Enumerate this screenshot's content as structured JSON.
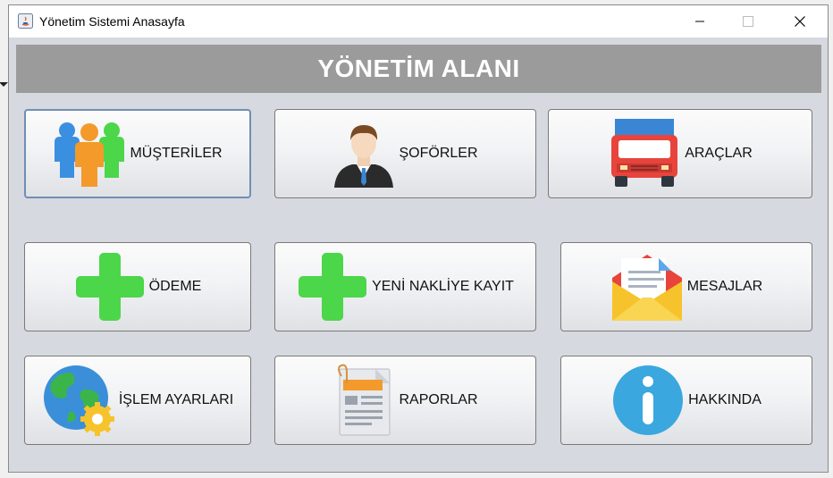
{
  "window": {
    "title": "Yönetim Sistemi Anasayfa",
    "controls": [
      "minimize",
      "maximize",
      "close"
    ]
  },
  "header": {
    "title": "YÖNETİM ALANI"
  },
  "buttons": {
    "musteriler": {
      "label": "MÜŞTERİLER",
      "icon": "people-icon",
      "focused": true
    },
    "soforler": {
      "label": "ŞOFÖRLER",
      "icon": "driver-icon"
    },
    "araclar": {
      "label": "ARAÇLAR",
      "icon": "truck-icon"
    },
    "odeme": {
      "label": "ÖDEME",
      "icon": "plus-icon"
    },
    "yeni_nakliye": {
      "label": "YENİ NAKLİYE KAYIT",
      "icon": "plus-icon"
    },
    "mesajlar": {
      "label": "MESAJLAR",
      "icon": "envelope-icon"
    },
    "islem_ayarlari": {
      "label": "İŞLEM AYARLARI",
      "icon": "globe-gear-icon"
    },
    "raporlar": {
      "label": "RAPORLAR",
      "icon": "report-icon"
    },
    "hakkinda": {
      "label": "HAKKINDA",
      "icon": "info-icon"
    }
  },
  "colors": {
    "header_bg": "#9b9b9b",
    "panel_bg": "#d6d9df",
    "plus_green": "#4cd64a",
    "truck_red": "#e8443c",
    "info_blue": "#3aa7df"
  }
}
